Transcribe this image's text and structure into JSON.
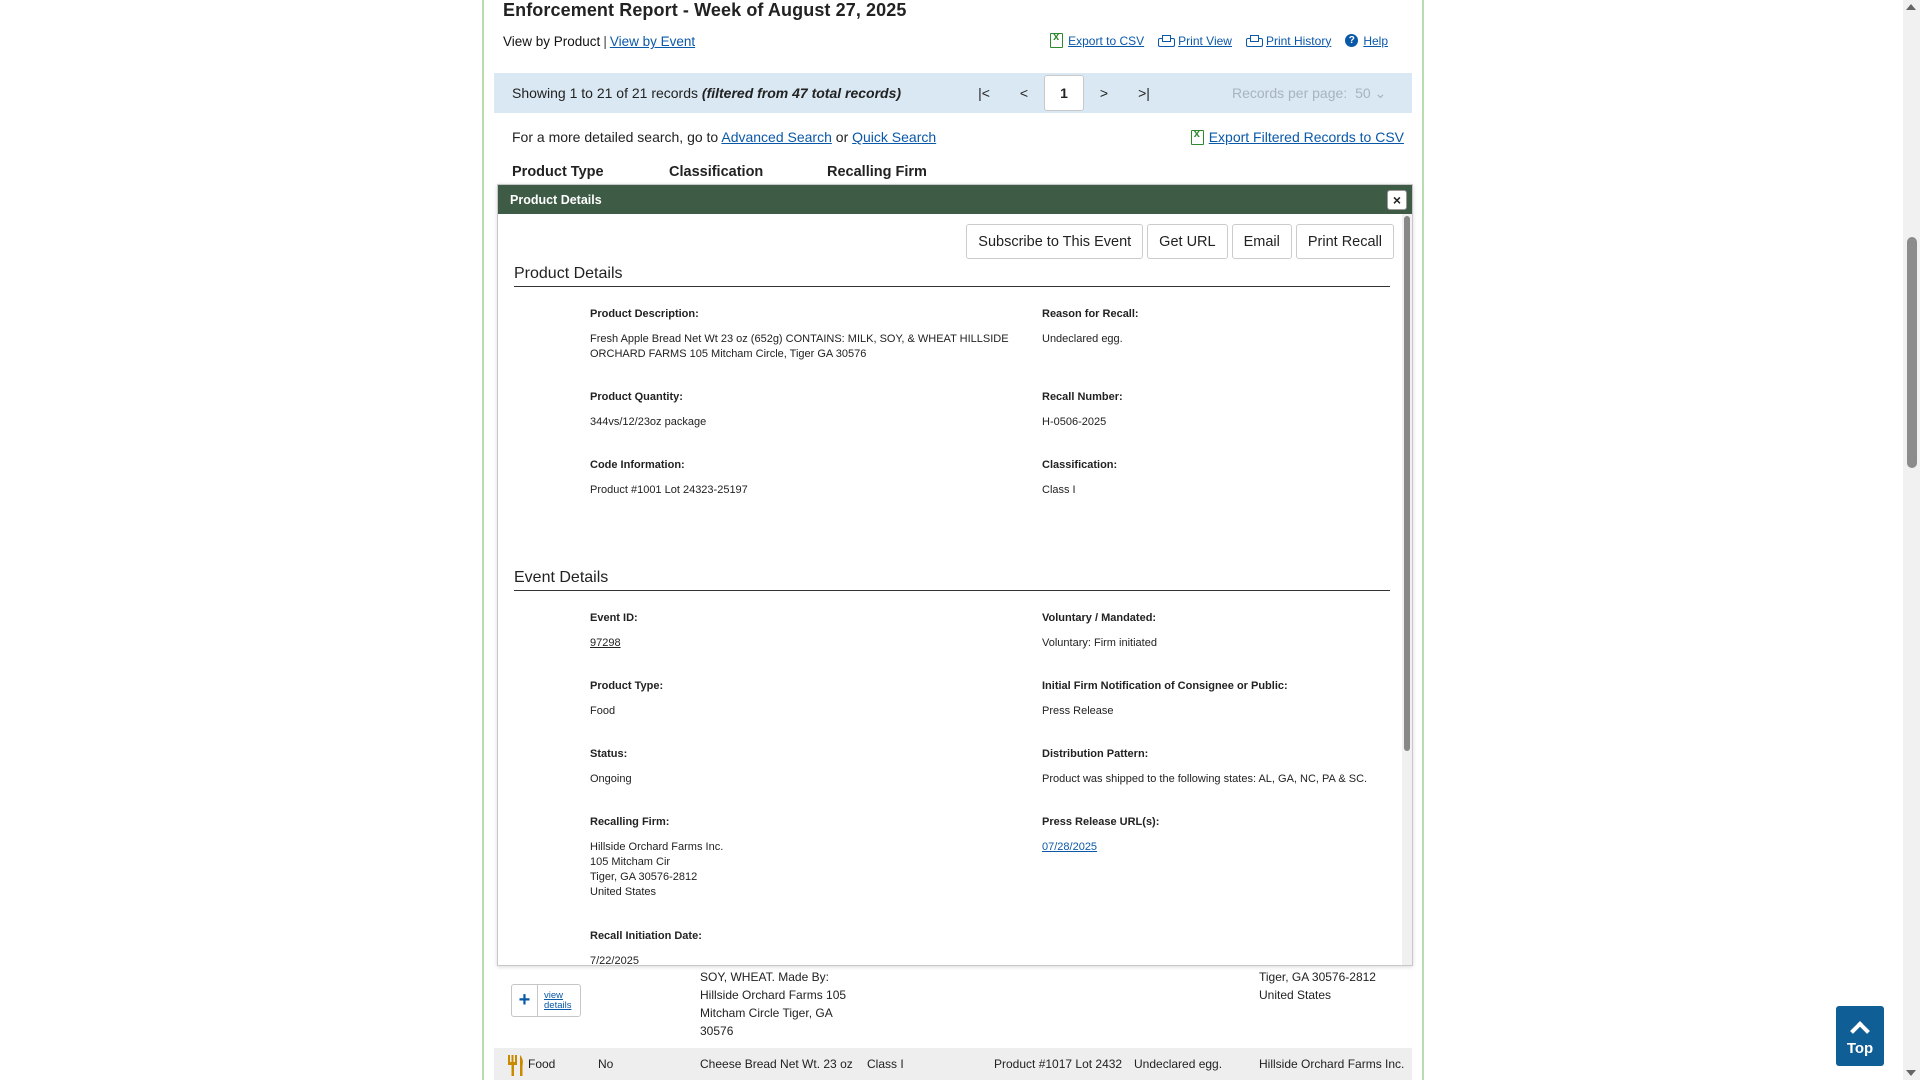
{
  "header": {
    "title": "Enforcement Report - Week of August 27, 2025",
    "view_by_product": "View by Product",
    "view_separator": "|",
    "view_by_event": "View by Event",
    "links": {
      "export_csv": "Export to CSV",
      "print_view": "Print View",
      "print_history": "Print History",
      "help": "Help"
    }
  },
  "records_bar": {
    "showing": "Showing 1 to 21 of 21 records",
    "filtered": "(filtered from 47 total records)",
    "pager": {
      "first": "|<",
      "prev": "<",
      "current": "1",
      "next": ">",
      "last": ">|"
    },
    "records_per_page_label": "Records per page:",
    "records_per_page_value": "50"
  },
  "search": {
    "prefix": "For a more detailed search, go to",
    "advanced": "Advanced Search",
    "or": "or",
    "quick": "Quick Search",
    "export_filtered": "Export Filtered Records to CSV"
  },
  "columns": {
    "product_type": "Product Type",
    "classification": "Classification",
    "recalling_firm": "Recalling Firm"
  },
  "modal": {
    "title": "Product Details",
    "close": "×",
    "actions": {
      "subscribe": "Subscribe to This Event",
      "get_url": "Get URL",
      "email": "Email",
      "print_recall": "Print Recall"
    },
    "product_section": {
      "title": "Product Details",
      "product_description_label": "Product Description:",
      "product_description": "Fresh Apple Bread Net Wt 23 oz (652g) CONTAINS: MILK, SOY, & WHEAT HILLSIDE ORCHARD FARMS 105 Mitcham Circle, Tiger GA 30576",
      "reason_label": "Reason for Recall:",
      "reason": "Undeclared egg.",
      "quantity_label": "Product Quantity:",
      "quantity": "344vs/12/23oz package",
      "recall_number_label": "Recall Number:",
      "recall_number": "H-0506-2025",
      "code_label": "Code Information:",
      "code": "Product #1001 Lot 24323-25197",
      "classification_label": "Classification:",
      "classification": "Class I"
    },
    "event_section": {
      "title": "Event Details",
      "event_id_label": "Event ID:",
      "event_id": "97298",
      "voluntary_label": "Voluntary / Mandated:",
      "voluntary": "Voluntary: Firm initiated",
      "product_type_label": "Product Type:",
      "product_type": "Food",
      "notification_label": "Initial Firm Notification of Consignee or Public:",
      "notification": "Press Release",
      "status_label": "Status:",
      "status": "Ongoing",
      "distribution_label": "Distribution Pattern:",
      "distribution": "Product was shipped to the following states: AL, GA, NC, PA & SC.",
      "firm_label": "Recalling Firm:",
      "firm": "Hillside Orchard Farms Inc.\n105 Mitcham Cir\nTiger, GA 30576-2812\nUnited States",
      "press_label": "Press Release URL(s):",
      "press": "07/28/2025",
      "initiation_label": "Recall Initiation Date:",
      "initiation": "7/22/2025"
    }
  },
  "table_rows": {
    "row1_description": "SOY, WHEAT. Made By:\nHillside Orchard Farms 105\nMitcham Circle Tiger, GA\n30576",
    "row1_firm": "Tiger, GA 30576-2812\nUnited States",
    "view_details": "view\ndetails",
    "row2": {
      "type": "Food",
      "mandated": "No",
      "description": "Cheese Bread Net Wt. 23 oz",
      "classification": "Class I",
      "code": "Product #1017 Lot 2432",
      "reason": "Undeclared egg.",
      "firm": "Hillside Orchard Farms Inc."
    }
  },
  "top_button": "Top",
  "colors": {
    "modal_header": "#3e5b45",
    "records_bar": "#d9e8f2",
    "link": "#0a58a8",
    "top_button": "#0f5e95"
  }
}
